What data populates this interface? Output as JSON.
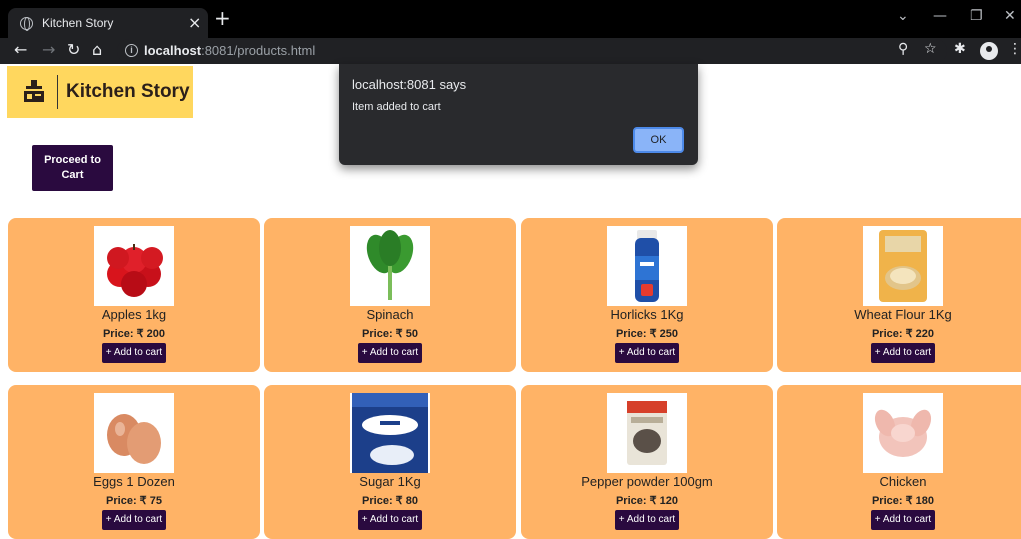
{
  "browser": {
    "tab_title": "Kitchen Story",
    "tab_close": "×",
    "new_tab": "+",
    "url_host": "localhost",
    "url_path": ":8081/products.html",
    "window_controls": {
      "minimize": "—",
      "restore": "❐",
      "close": "✕",
      "dropdown": "⌄"
    }
  },
  "header": {
    "logo_text": "Kitchen Story",
    "proceed_button": "Proceed to Cart"
  },
  "products": [
    {
      "name": "Apples 1kg",
      "price": "Price: ₹ 200",
      "button": "+ Add to cart",
      "icon": "apples-image"
    },
    {
      "name": "Spinach",
      "price": "Price: ₹ 50",
      "button": "+ Add to cart",
      "icon": "spinach-image"
    },
    {
      "name": "Horlicks 1Kg",
      "price": "Price: ₹ 250",
      "button": "+ Add to cart",
      "icon": "horlicks-image"
    },
    {
      "name": "Wheat Flour 1Kg",
      "price": "Price: ₹ 220",
      "button": "+ Add to cart",
      "icon": "wheat-flour-image"
    },
    {
      "name": "Eggs 1 Dozen",
      "price": "Price: ₹ 75",
      "button": "+ Add to cart",
      "icon": "eggs-image"
    },
    {
      "name": "Sugar 1Kg",
      "price": "Price: ₹ 80",
      "button": "+ Add to cart",
      "icon": "sugar-image"
    },
    {
      "name": "Pepper powder 100gm",
      "price": "Price: ₹ 120",
      "button": "+ Add to cart",
      "icon": "pepper-image"
    },
    {
      "name": "Chicken",
      "price": "Price: ₹ 180",
      "button": "+ Add to cart",
      "icon": "chicken-image"
    }
  ],
  "dialog": {
    "title": "localhost:8081 says",
    "message": "Item added to cart",
    "ok_label": "OK"
  },
  "colors": {
    "card_bg": "#ffb366",
    "button_bg": "#2a0a3f",
    "logo_bg": "#ffd75e"
  }
}
